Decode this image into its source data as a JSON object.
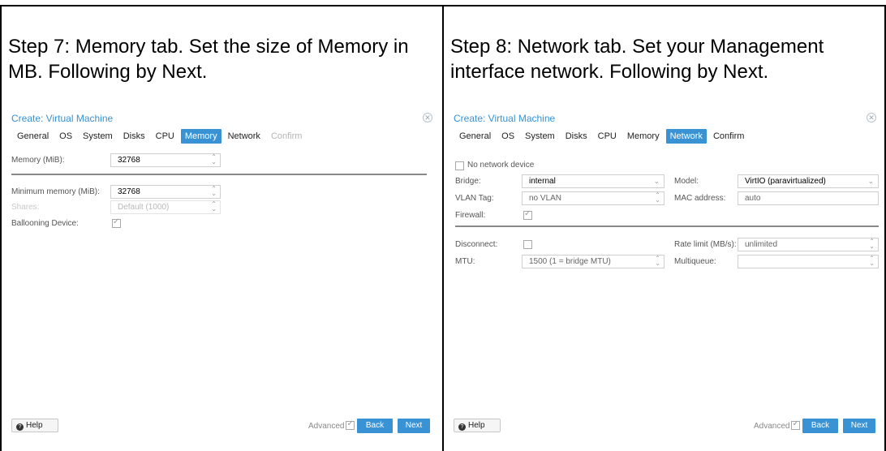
{
  "left": {
    "caption": "Step 7: Memory tab. Set the size of Memory in MB. Following by Next.",
    "dialog": {
      "title": "Create: Virtual Machine",
      "tabs": [
        "General",
        "OS",
        "System",
        "Disks",
        "CPU",
        "Memory",
        "Network",
        "Confirm"
      ],
      "active_tab": "Memory",
      "memory_label": "Memory (MiB):",
      "memory_value": "32768",
      "min_memory_label": "Minimum memory (MiB):",
      "min_memory_value": "32768",
      "shares_label": "Shares:",
      "shares_placeholder": "Default (1000)",
      "ballooning_label": "Ballooning Device:",
      "help_label": "Help",
      "advanced_label": "Advanced",
      "back_label": "Back",
      "next_label": "Next"
    }
  },
  "right": {
    "caption": "Step 8: Network tab. Set your Management interface network. Following by Next.",
    "dialog": {
      "title": "Create: Virtual Machine",
      "tabs": [
        "General",
        "OS",
        "System",
        "Disks",
        "CPU",
        "Memory",
        "Network",
        "Confirm"
      ],
      "active_tab": "Network",
      "no_network_label": "No network device",
      "bridge_label": "Bridge:",
      "bridge_value": "internal",
      "vlan_label": "VLAN Tag:",
      "vlan_value": "no VLAN",
      "firewall_label": "Firewall:",
      "model_label": "Model:",
      "model_value": "VirtIO (paravirtualized)",
      "mac_label": "MAC address:",
      "mac_value": "auto",
      "disconnect_label": "Disconnect:",
      "mtu_label": "MTU:",
      "mtu_value": "1500 (1 = bridge MTU)",
      "rate_label": "Rate limit (MB/s):",
      "rate_value": "unlimited",
      "multiqueue_label": "Multiqueue:",
      "help_label": "Help",
      "advanced_label": "Advanced",
      "back_label": "Back",
      "next_label": "Next"
    }
  },
  "colors": {
    "accent": "#3892d4"
  },
  "icons": [
    "close-icon",
    "help-icon",
    "checkbox-icon",
    "spinner-icon",
    "dropdown-icon"
  ]
}
